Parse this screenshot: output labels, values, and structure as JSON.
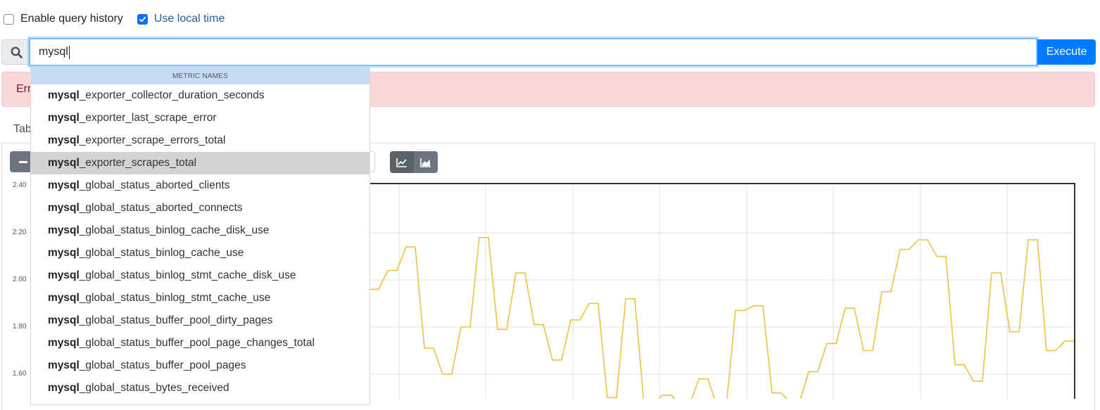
{
  "options": {
    "query_history_label": "Enable query history",
    "query_history_checked": false,
    "local_time_label": "Use local time",
    "local_time_checked": true
  },
  "query": {
    "value": "mysql",
    "execute_label": "Execute"
  },
  "error": {
    "text": "Err"
  },
  "tabs": {
    "table_label_partial": "Tab"
  },
  "autocomplete": {
    "header": "METRIC NAMES",
    "match": "mysql",
    "highlighted_index": 3,
    "items": [
      {
        "prefix": "mysql",
        "suffix": "_exporter_collector_duration_seconds"
      },
      {
        "prefix": "mysql",
        "suffix": "_exporter_last_scrape_error"
      },
      {
        "prefix": "mysql",
        "suffix": "_exporter_scrape_errors_total"
      },
      {
        "prefix": "mysql",
        "suffix": "_exporter_scrapes_total"
      },
      {
        "prefix": "mysql",
        "suffix": "_global_status_aborted_clients"
      },
      {
        "prefix": "mysql",
        "suffix": "_global_status_aborted_connects"
      },
      {
        "prefix": "mysql",
        "suffix": "_global_status_binlog_cache_disk_use"
      },
      {
        "prefix": "mysql",
        "suffix": "_global_status_binlog_cache_use"
      },
      {
        "prefix": "mysql",
        "suffix": "_global_status_binlog_stmt_cache_disk_use"
      },
      {
        "prefix": "mysql",
        "suffix": "_global_status_binlog_stmt_cache_use"
      },
      {
        "prefix": "mysql",
        "suffix": "_global_status_buffer_pool_dirty_pages"
      },
      {
        "prefix": "mysql",
        "suffix": "_global_status_buffer_pool_page_changes_total"
      },
      {
        "prefix": "mysql",
        "suffix": "_global_status_buffer_pool_pages"
      },
      {
        "prefix": "mysql",
        "suffix": "_global_status_bytes_received"
      }
    ]
  },
  "chart_data": {
    "type": "line",
    "y_ticks": [
      "2.40",
      "2.20",
      "2.00",
      "1.80",
      "1.60"
    ],
    "ylim": [
      1.48,
      2.4
    ],
    "grid": true,
    "series_color": "#edc240",
    "series": [
      {
        "values": [
          1.96,
          1.96,
          2.04,
          2.04,
          2.14,
          2.14,
          1.71,
          1.71,
          1.6,
          1.6,
          1.8,
          1.8,
          2.18,
          2.18,
          1.79,
          1.79,
          2.03,
          2.03,
          1.81,
          1.81,
          1.66,
          1.66,
          1.83,
          1.83,
          1.9,
          1.9,
          1.5,
          1.5,
          1.92,
          1.92,
          1.47,
          1.47,
          1.51,
          1.51,
          1.47,
          1.47,
          1.58,
          1.58,
          1.46,
          1.46,
          1.87,
          1.87,
          1.89,
          1.89,
          1.52,
          1.52,
          1.48,
          1.48,
          1.61,
          1.61,
          1.73,
          1.73,
          1.88,
          1.88,
          1.7,
          1.7,
          1.95,
          1.95,
          2.13,
          2.13,
          2.17,
          2.17,
          2.1,
          2.1,
          1.64,
          1.64,
          1.57,
          1.57,
          2.03,
          2.03,
          1.78,
          1.78,
          2.17,
          2.17,
          1.7,
          1.7,
          1.74,
          1.74
        ]
      }
    ]
  }
}
